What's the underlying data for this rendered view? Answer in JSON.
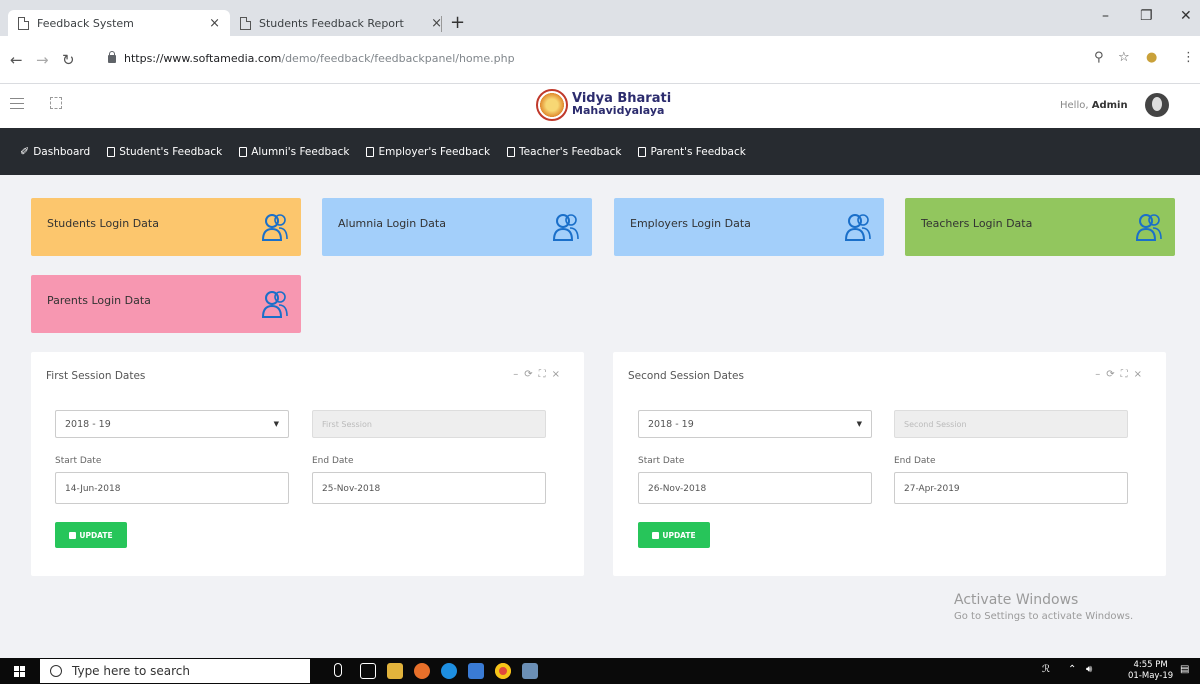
{
  "browser": {
    "tabs": [
      {
        "title": "Feedback System",
        "close": "×"
      },
      {
        "title": "Students Feedback Report",
        "close": "×"
      }
    ],
    "new_tab": "+",
    "url_host": "https://www.softamedia.com",
    "url_path": "/demo/feedback/feedbackpanel/home.php"
  },
  "header": {
    "logo_line1": "Vidya Bharati",
    "logo_line2": "Mahavidyalaya",
    "greeting": "Hello,",
    "user": "Admin"
  },
  "nav": {
    "items": [
      "Dashboard",
      "Student's Feedback",
      "Alumni's Feedback",
      "Employer's Feedback",
      "Teacher's Feedback",
      "Parent's Feedback"
    ]
  },
  "cards": [
    {
      "label": "Students Login Data",
      "color": "#fcc66d"
    },
    {
      "label": "Alumnia Login Data",
      "color": "#a3cffa"
    },
    {
      "label": "Employers Login Data",
      "color": "#a3cffa"
    },
    {
      "label": "Teachers Login Data",
      "color": "#92c65e"
    },
    {
      "label": "Parents Login Data",
      "color": "#f797b1"
    }
  ],
  "panels": [
    {
      "title": "First Session Dates",
      "year": "2018 - 19",
      "session_placeholder": "First Session",
      "start_label": "Start Date",
      "end_label": "End Date",
      "start_date": "14-Jun-2018",
      "end_date": "25-Nov-2018",
      "button": "UPDATE"
    },
    {
      "title": "Second Session Dates",
      "year": "2018 - 19",
      "session_placeholder": "Second Session",
      "start_label": "Start Date",
      "end_label": "End Date",
      "start_date": "26-Nov-2018",
      "end_date": "27-Apr-2019",
      "button": "UPDATE"
    }
  ],
  "watermark": {
    "line1": "Activate Windows",
    "line2": "Go to Settings to activate Windows."
  },
  "taskbar": {
    "search_placeholder": "Type here to search",
    "time": "4:55 PM",
    "date": "01-May-19"
  }
}
